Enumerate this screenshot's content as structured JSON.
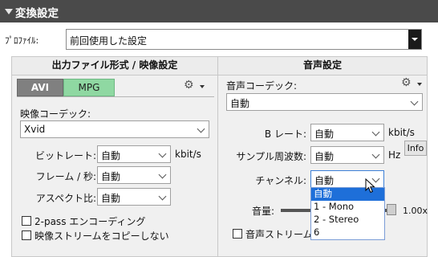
{
  "window": {
    "title": "変換設定"
  },
  "profile": {
    "label": "ﾌﾟﾛﾌｧｲﾙ:",
    "value": "前回使用した設定"
  },
  "video_panel": {
    "title": "出力ファイル形式 / 映像設定",
    "tabs": [
      {
        "label": "AVI",
        "active": true
      },
      {
        "label": "MPG",
        "active": false
      }
    ],
    "codec_label": "映像コーデック:",
    "codec_value": "Xvid",
    "bitrate": {
      "label": "ビットレート:",
      "value": "自動",
      "unit": "kbit/s"
    },
    "framerate": {
      "label": "フレーム / 秒:",
      "value": "自動"
    },
    "aspect": {
      "label": "アスペクト比:",
      "value": "自動"
    },
    "two_pass": {
      "label": "2-pass エンコーディング",
      "checked": false
    },
    "no_copy_video": {
      "label": "映像ストリームをコピーしない",
      "checked": false
    }
  },
  "audio_panel": {
    "title": "音声設定",
    "codec_label": "音声コーデック:",
    "codec_value": "自動",
    "bitrate": {
      "label": "B レート:",
      "value": "自動",
      "unit": "kbit/s"
    },
    "samplerate": {
      "label": "サンプル周波数:",
      "value": "自動",
      "unit": "Hz"
    },
    "info_label": "Info",
    "channels": {
      "label": "チャンネル:",
      "value": "自動",
      "options": [
        "自動",
        "1 - Mono",
        "2 - Stereo",
        "6"
      ],
      "highlighted": "自動"
    },
    "volume": {
      "label": "音量:",
      "value_label": "1.00x"
    },
    "no_copy_audio": {
      "label": "音声ストリームを",
      "checked": false
    }
  },
  "icons": {
    "title": "triangle-down-icon",
    "gear": "gear-icon",
    "cursor": "mouse-pointer-icon"
  },
  "colors": {
    "titlebar": "#4a4a4a",
    "tab_active": "#808080",
    "tab_mpg": "#8fd8a2",
    "selection": "#1e6fd9"
  }
}
